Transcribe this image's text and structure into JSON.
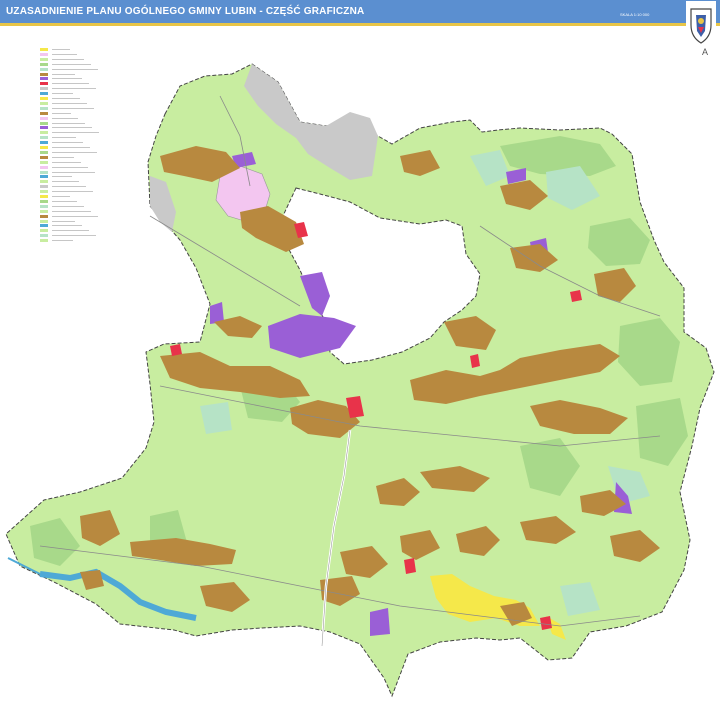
{
  "header": {
    "title": "UZASADNIENIE PLANU OGÓLNEGO GMINY LUBIN - CZĘŚĆ GRAFICZNA",
    "scale": "SKALA 1:10 000",
    "north_symbol": "A",
    "crest_icon": "municipal-crest-icon"
  },
  "colors": {
    "header_bg": "#5b8fd0",
    "header_accent": "#e8c547",
    "farmland": "#c8eda0",
    "forest": "#a8d98a",
    "meadow": "#b6e3c6",
    "settlement": "#b8893f",
    "industrial": "#9a5fd6",
    "mining_area": "#c9c9c9",
    "special_area": "#f3c6f0",
    "services": "#e8334a",
    "recreation": "#f5e84a",
    "water": "#4ea9d6",
    "boundary": "#444444"
  },
  "map": {
    "municipality": "Gmina Lubin"
  }
}
